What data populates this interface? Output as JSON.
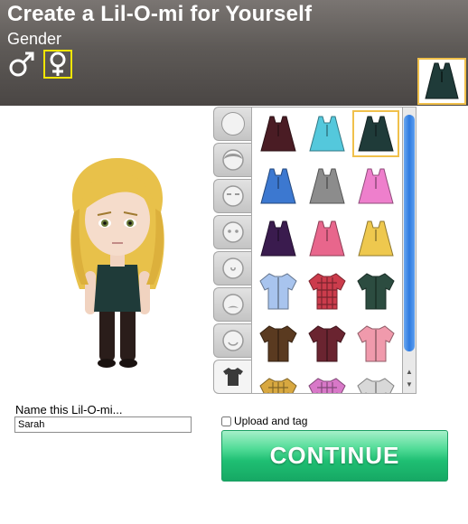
{
  "header": {
    "title": "Create a Lil-O-mi for Yourself",
    "gender_label": "Gender",
    "gender_options": [
      {
        "name": "male",
        "icon": "male-symbol-icon",
        "selected": false
      },
      {
        "name": "female",
        "icon": "female-symbol-icon",
        "selected": true
      }
    ],
    "current_item_icon": "dark-green-top-icon"
  },
  "category_tabs": [
    {
      "icon": "blank-face-icon",
      "active": false
    },
    {
      "icon": "hair-icon",
      "active": false
    },
    {
      "icon": "eyebrows-icon",
      "active": false
    },
    {
      "icon": "eyes-icon",
      "active": false
    },
    {
      "icon": "nose-icon",
      "active": false
    },
    {
      "icon": "facial-hair-icon",
      "active": false
    },
    {
      "icon": "mouth-icon",
      "active": false
    },
    {
      "icon": "shirt-icon",
      "active": true
    }
  ],
  "clothing_grid": [
    {
      "color": "#4a1c24",
      "kind": "top",
      "selected": false
    },
    {
      "color": "#54c8dc",
      "kind": "top",
      "selected": false
    },
    {
      "color": "#1f3b39",
      "kind": "top",
      "selected": true
    },
    {
      "color": "#3c78d0",
      "kind": "top",
      "selected": false
    },
    {
      "color": "#8c8c8c",
      "kind": "top",
      "selected": false
    },
    {
      "color": "#ee7fcc",
      "kind": "top",
      "selected": false
    },
    {
      "color": "#3a1b4e",
      "kind": "top",
      "selected": false
    },
    {
      "color": "#e8668c",
      "kind": "top",
      "selected": false
    },
    {
      "color": "#eec84e",
      "kind": "top",
      "selected": false
    },
    {
      "color": "#a8c4ee",
      "kind": "shirt",
      "selected": false
    },
    {
      "color": "#cc3c4c",
      "kind": "plaid",
      "selected": false
    },
    {
      "color": "#2c4c40",
      "kind": "shirt",
      "selected": false
    },
    {
      "color": "#5a3a20",
      "kind": "shirt",
      "selected": false
    },
    {
      "color": "#6a2430",
      "kind": "shirt",
      "selected": false
    },
    {
      "color": "#f09aac",
      "kind": "shirt",
      "selected": false
    },
    {
      "color": "#d8a840",
      "kind": "plaid",
      "selected": false
    },
    {
      "color": "#d878c8",
      "kind": "plaid",
      "selected": false
    },
    {
      "color": "#d8d8d8",
      "kind": "shirt",
      "selected": false
    }
  ],
  "form": {
    "name_label": "Name this Lil-O-mi...",
    "name_value": "Sarah",
    "upload_label": "Upload and tag",
    "upload_checked": false,
    "continue_label": "CONTINUE"
  },
  "colors": {
    "header_bg": "#5e5a57",
    "selection_outline": "#f0c04b",
    "gender_selected_outline": "#f2e600",
    "continue_green": "#1fbf73",
    "scroll_thumb": "#2f7be0"
  }
}
